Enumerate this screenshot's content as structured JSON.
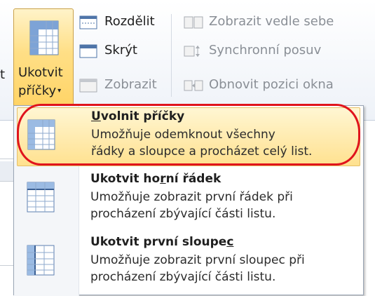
{
  "ribbon": {
    "freeze_button": {
      "label_line1": "Ukotvit",
      "label_line2": "příčky",
      "arrow": "▾"
    },
    "cut_text": "t",
    "commands": [
      {
        "id": "split",
        "label": "Rozdělit",
        "enabled": true,
        "icon": "split-icon"
      },
      {
        "id": "hide",
        "label": "Skrýt",
        "enabled": true,
        "icon": "hide-icon"
      },
      {
        "id": "show",
        "label": "Zobrazit",
        "enabled": false,
        "icon": "unhide-icon"
      },
      {
        "id": "side_by_side",
        "label": "Zobrazit vedle sebe",
        "enabled": false,
        "icon": "side-by-side-icon"
      },
      {
        "id": "sync_scroll",
        "label": "Synchronní posuv",
        "enabled": false,
        "icon": "sync-scroll-icon"
      },
      {
        "id": "reset_position",
        "label": "Obnovit pozici okna",
        "enabled": false,
        "icon": "reset-window-icon"
      }
    ]
  },
  "menu": {
    "items": [
      {
        "title_pre": "",
        "title_u": "U",
        "title_post": "volnit příčky",
        "desc1": "Umožňuje odemknout všechny",
        "desc2": "řádky a sloupce a procházet celý list.",
        "highlighted": true,
        "icon": "unfreeze-panes-icon"
      },
      {
        "title_pre": "Ukotvit ho",
        "title_u": "r",
        "title_post": "ní řádek",
        "desc1": "Umožňuje zobrazit první řádek při",
        "desc2": "procházení zbývající části listu.",
        "highlighted": false,
        "icon": "freeze-top-row-icon"
      },
      {
        "title_pre": "Ukotvit první sloupe",
        "title_u": "c",
        "title_post": "",
        "desc1": "Umožňuje zobrazit první sloupec při",
        "desc2": "procházení zbývající části listu.",
        "highlighted": false,
        "icon": "freeze-first-column-icon"
      }
    ]
  },
  "colors": {
    "highlight_border": "#e0141c",
    "hover_fill": "#ffe18f",
    "disabled_text": "#8a8f96"
  }
}
